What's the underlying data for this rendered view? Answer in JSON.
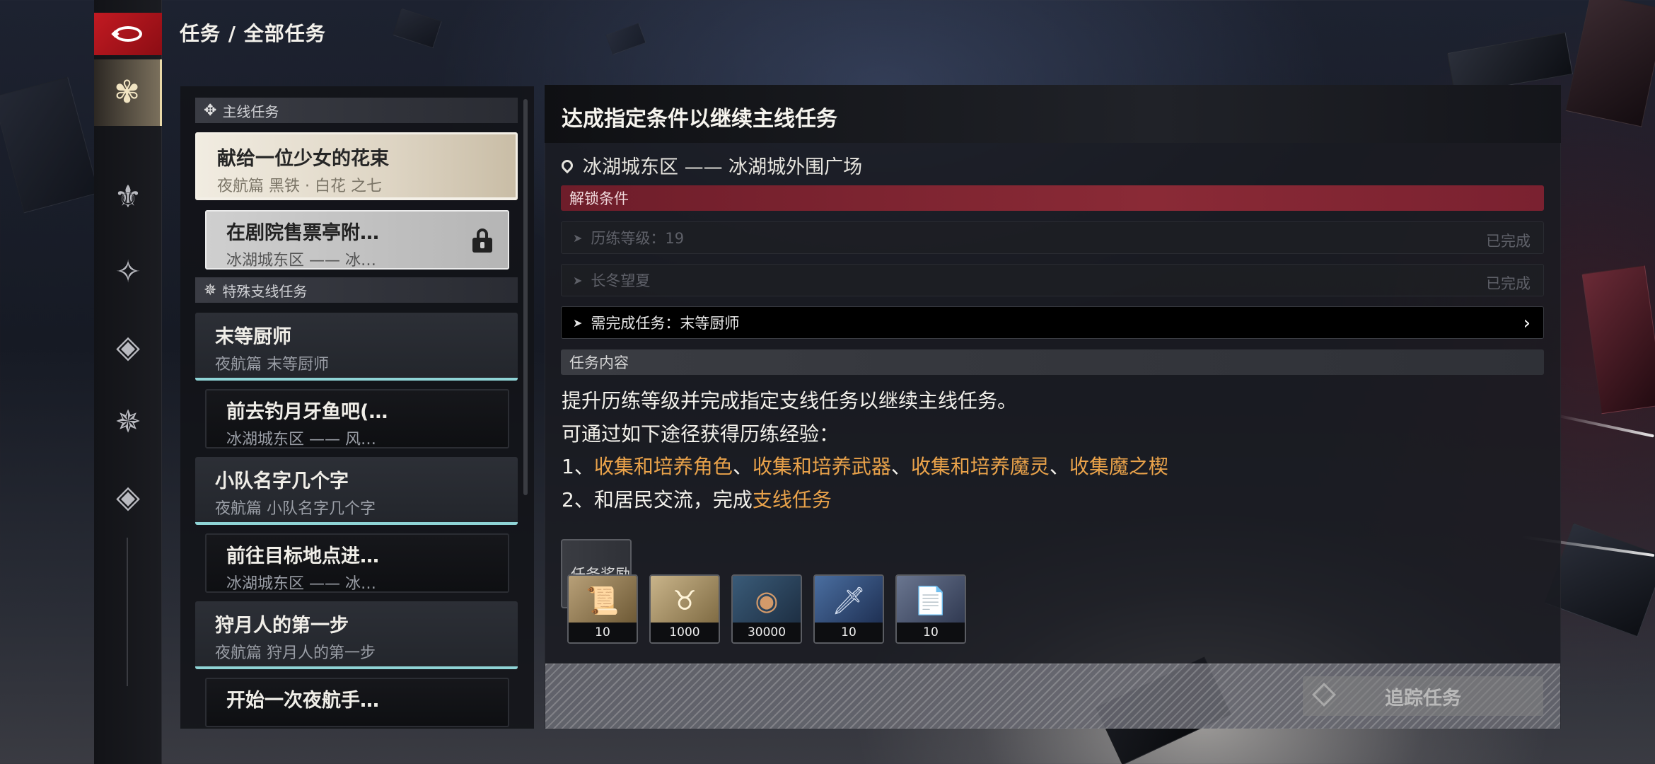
{
  "header": {
    "breadcrumb": "任务 / 全部任务"
  },
  "rail": {
    "items": [
      {
        "icon": "flower-emblem-icon",
        "glyph": "✾",
        "active": true
      },
      {
        "icon": "fleur-emblem-icon",
        "glyph": "⚜"
      },
      {
        "icon": "star-diamond-icon",
        "glyph": "✧"
      },
      {
        "icon": "diamond-shield-icon",
        "glyph": "◈"
      },
      {
        "icon": "gear-emblem-icon",
        "glyph": "✵"
      },
      {
        "icon": "diamond-icon",
        "glyph": "◈"
      }
    ]
  },
  "task_list": {
    "main_header": "主线任务",
    "side_header": "特殊支线任务",
    "tasks": [
      {
        "name": "献给一位少女的花束",
        "sub": "夜航篇 黑铁 · 白花 之七"
      },
      {
        "name": "在剧院售票亭附…",
        "sub": "冰湖城东区 —— 冰…"
      },
      {
        "name": "末等厨师",
        "sub": "夜航篇 末等厨师"
      },
      {
        "name": "前去钓月牙鱼吧(…",
        "sub": "冰湖城东区 —— 风…"
      },
      {
        "name": "小队名字几个字",
        "sub": "夜航篇 小队名字几个字"
      },
      {
        "name": "前往目标地点进…",
        "sub": "冰湖城东区 —— 冰…"
      },
      {
        "name": "狩月人的第一步",
        "sub": "夜航篇 狩月人的第一步"
      },
      {
        "name": "开始一次夜航手…",
        "sub": ""
      }
    ]
  },
  "detail": {
    "title": "达成指定条件以继续主线任务",
    "location": "冰湖城东区 —— 冰湖城外围广场",
    "unlock_label": "解锁条件",
    "conditions": [
      {
        "text": "历练等级：19",
        "status": "已完成"
      },
      {
        "text": "长冬望夏",
        "status": "已完成"
      },
      {
        "text": "需完成任务：末等厨师",
        "status": ""
      }
    ],
    "content_label": "任务内容",
    "lines": {
      "l1": "提升历练等级并完成指定支线任务以继续主线任务。",
      "l2": "可通过如下途径获得历练经验：",
      "l3_prefix": "1、",
      "l3_a": "收集和培养角色",
      "sep1": "、",
      "l3_b": "收集和培养武器",
      "sep2": "、",
      "l3_c": "收集和培养魔灵",
      "sep3": "、",
      "l3_d": "收集魔之楔",
      "l4_prefix": "2、和居民交流，完成",
      "l4_link": "支线任务"
    },
    "reward_label": "任务奖励",
    "rewards": [
      {
        "icon": "scroll-item-icon",
        "glyph": "📜",
        "qty": "10"
      },
      {
        "icon": "horned-emblem-icon",
        "glyph": "♉",
        "qty": "1000"
      },
      {
        "icon": "bronze-coin-icon",
        "glyph": "◉",
        "qty": "30000"
      },
      {
        "icon": "sword-card-icon",
        "glyph": "🗡",
        "qty": "10"
      },
      {
        "icon": "document-item-icon",
        "glyph": "📄",
        "qty": "10"
      }
    ],
    "track_button": "追踪任务"
  },
  "colors": {
    "accent_red": "#c21a22",
    "highlight": "#e9a24a",
    "unlock_bar": "#8a2a36",
    "task_underline": "#8fd4d6"
  }
}
